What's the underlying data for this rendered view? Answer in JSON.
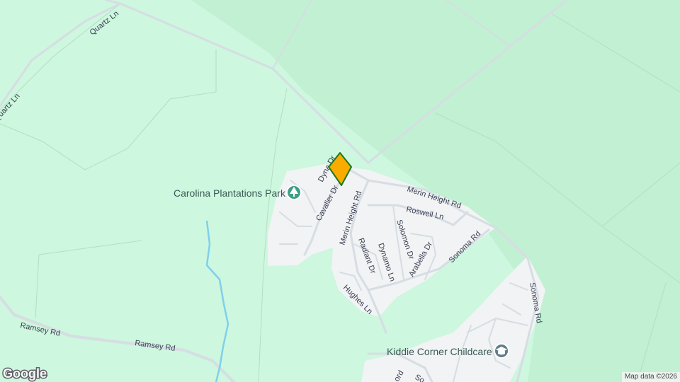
{
  "map": {
    "colors": {
      "land": "#cdf7de",
      "forest": "#c1f0d3",
      "residential": "#f1f3f4",
      "road": "#d6dde3",
      "water": "#7fd0eb",
      "pin": "#f9ab00",
      "pin_outline": "#19791e",
      "park_icon": "#3f9f86",
      "school_icon": "#607d8b"
    },
    "roads": {
      "quartz_ln_1": "Quartz Ln",
      "quartz_ln_2": "Quartz Ln",
      "dyna_dr": "Dyna   Dr",
      "cavalier_dr": "Cavalier Dr",
      "merin_height_rd_1": "Merin Height Rd",
      "merin_height_rd_2": "Merin Height Rd",
      "roswell_ln": "Roswell Ln",
      "solomon_dr": "Solomon Dr",
      "radiant_dr": "Radiant Dr",
      "dynamo_ln": "Dynamo Ln",
      "arabella_dr": "Arabella Dr",
      "sonoma_rd_1": "Sonoma Rd",
      "sonoma_rd_2": "Sonoma Rd",
      "hughes_ln": "Hughes Ln",
      "ramsey_rd_1": "Ramsey Rd",
      "ramsey_rd_2": "Ramsey Rd",
      "cut_1": "ord",
      "cut_2": "So"
    },
    "pois": {
      "park": "Carolina Plantations Park",
      "park_icon": "tree-icon",
      "childcare": "Kiddie Corner Childcare",
      "childcare_icon": "graduation-cap-icon"
    },
    "marker": {
      "icon": "location-pin-icon"
    },
    "logo": "Google",
    "attribution": "Map data ©2026"
  }
}
